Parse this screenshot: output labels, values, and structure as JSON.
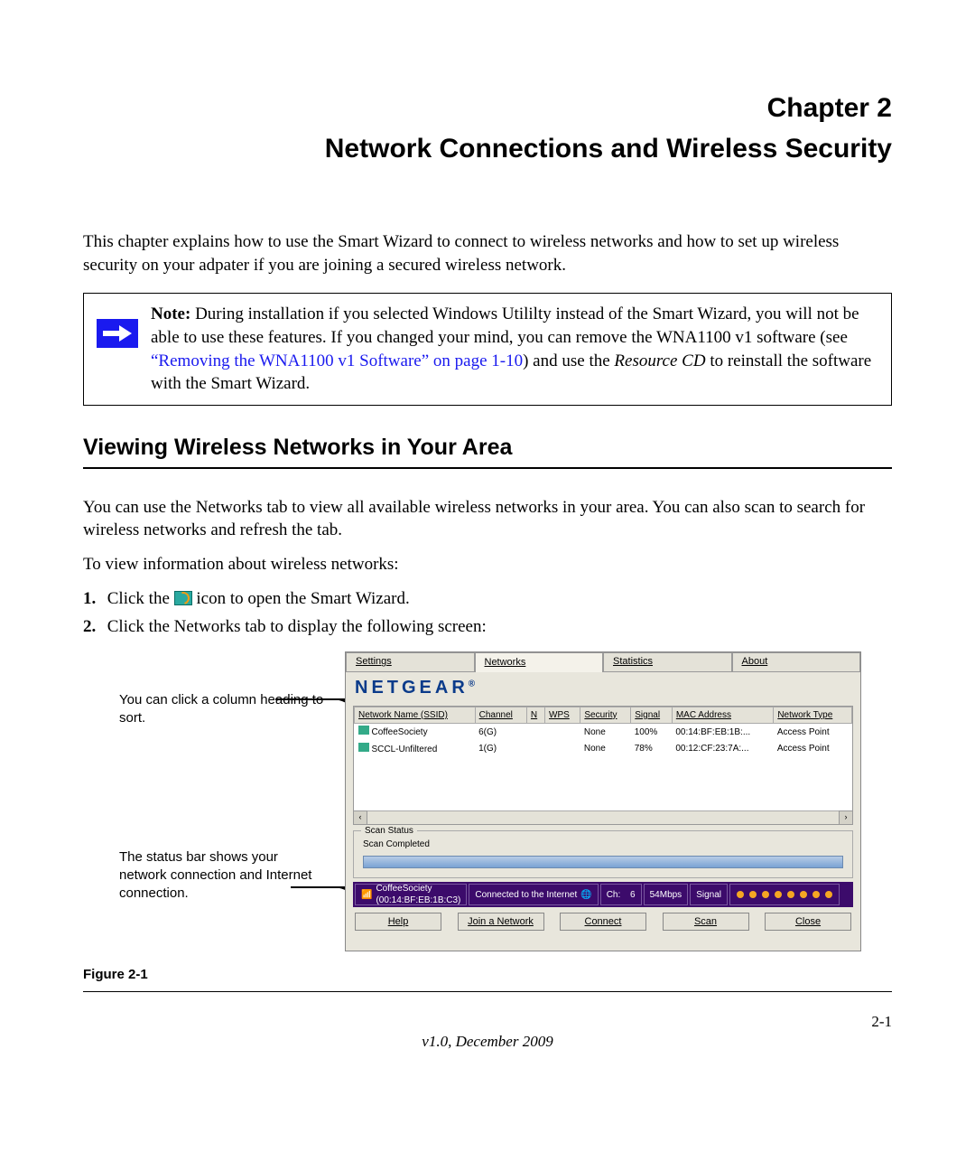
{
  "chapter": {
    "title": "Chapter 2",
    "subtitle": "Network Connections and Wireless Security"
  },
  "intro": "This chapter explains how to use the Smart Wizard to connect to wireless networks and how to set up wireless security on your adpater if you are joining a secured wireless network.",
  "note": {
    "label": "Note:",
    "text1": " During installation if you selected Windows Utililty instead of the Smart Wizard, you will not be able to use these features. If you changed your mind, you can remove the WNA1100 v1 software (see ",
    "link": "“Removing the WNA1100 v1 Software” on page 1-10",
    "text2": ") and use the ",
    "italic": "Resource CD",
    "text3": " to reinstall the software with the Smart Wizard."
  },
  "section_heading": "Viewing Wireless Networks in Your Area",
  "para1": "You can use the Networks tab to view all available wireless networks in your area. You can also scan to search for wireless networks and refresh the tab.",
  "para2": "To view information about wireless networks:",
  "steps": {
    "s1_num": "1.",
    "s1a": "Click the ",
    "s1b": " icon to open the Smart Wizard.",
    "s2_num": "2.",
    "s2": "Click the Networks tab to display the following screen:"
  },
  "callouts": {
    "c1": "You can click a column heading to sort.",
    "c2": "The status bar shows your network connection and Internet connection."
  },
  "app": {
    "tabs": [
      "Settings",
      "Networks",
      "Statistics",
      "About"
    ],
    "brand": "NETGEAR",
    "columns": [
      "Network Name (SSID)",
      "Channel",
      "N",
      "WPS",
      "Security",
      "Signal",
      "MAC Address",
      "Network Type"
    ],
    "rows": [
      {
        "ssid": "CoffeeSociety",
        "channel": "6(G)",
        "n": "",
        "wps": "",
        "security": "None",
        "signal": "100%",
        "mac": "00:14:BF:EB:1B:...",
        "type": "Access Point"
      },
      {
        "ssid": "SCCL-Unfiltered",
        "channel": "1(G)",
        "n": "",
        "wps": "",
        "security": "None",
        "signal": "78%",
        "mac": "00:12:CF:23:7A:...",
        "type": "Access Point"
      }
    ],
    "scan": {
      "label": "Scan Status",
      "text": "Scan Completed"
    },
    "status": {
      "net": "CoffeeSociety",
      "mac": "(00:14:BF:EB:1B:C3)",
      "inet": "Connected to the Internet",
      "ch_label": "Ch:",
      "ch": "6",
      "rate": "54Mbps",
      "signal": "Signal"
    },
    "buttons": [
      "Help",
      "Join a Network",
      "Connect",
      "Scan",
      "Close"
    ]
  },
  "figure_caption": "Figure 2-1",
  "footer": {
    "page": "2-1",
    "version": "v1.0, December 2009"
  },
  "chart_data": {
    "type": "table",
    "title": "Available Wireless Networks",
    "columns": [
      "Network Name (SSID)",
      "Channel",
      "N",
      "WPS",
      "Security",
      "Signal",
      "MAC Address",
      "Network Type"
    ],
    "rows": [
      [
        "CoffeeSociety",
        "6(G)",
        "",
        "",
        "None",
        "100%",
        "00:14:BF:EB:1B:...",
        "Access Point"
      ],
      [
        "SCCL-Unfiltered",
        "1(G)",
        "",
        "",
        "None",
        "78%",
        "00:12:CF:23:7A:...",
        "Access Point"
      ]
    ]
  }
}
